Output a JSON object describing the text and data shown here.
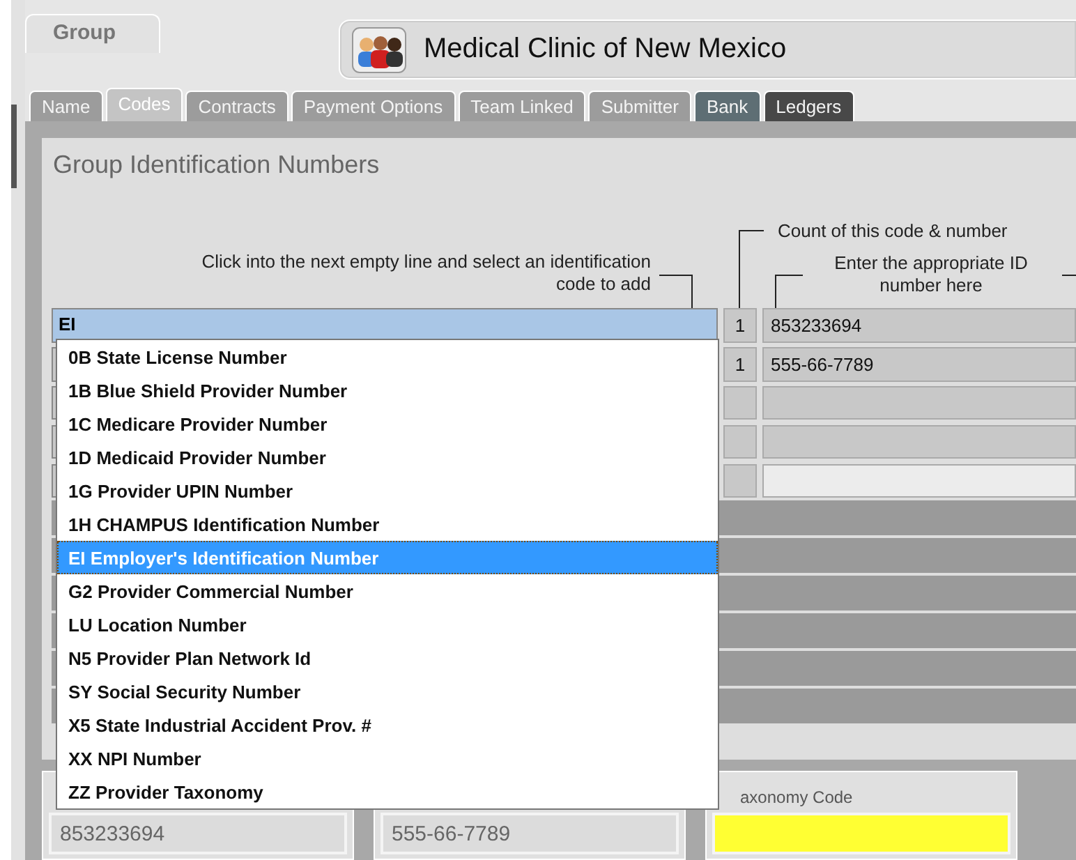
{
  "group_tab": {
    "label": "Group",
    "selected": true
  },
  "header": {
    "title": "Medical Clinic of New Mexico"
  },
  "tabs": [
    {
      "label": "Name",
      "selected": false,
      "color": "#9c9c9c"
    },
    {
      "label": "Codes",
      "selected": true,
      "color": "#c4c4c4"
    },
    {
      "label": "Contracts",
      "selected": false,
      "color": "#9c9c9c"
    },
    {
      "label": "Payment Options",
      "selected": false,
      "color": "#9c9c9c"
    },
    {
      "label": "Team Linked",
      "selected": false,
      "color": "#9c9c9c"
    },
    {
      "label": "Submitter",
      "selected": false,
      "color": "#9c9c9c"
    },
    {
      "label": "Bank",
      "selected": false,
      "color": "#5e6e74"
    },
    {
      "label": "Ledgers",
      "selected": false,
      "color": "#484848"
    }
  ],
  "section_title": "Group Identification Numbers",
  "hints": {
    "code": "Click into the next empty line and select an identification code to add",
    "count": "Count of this code & number",
    "id_number": "Enter the appropriate ID number here"
  },
  "code_field": {
    "value": "EI"
  },
  "rows": [
    {
      "count": "1",
      "id_number": "853233694"
    },
    {
      "count": "1",
      "id_number": "555-66-7789"
    },
    {},
    {},
    {
      "focused": true
    }
  ],
  "dropdown": [
    {
      "label": "0B State License Number",
      "selected": false
    },
    {
      "label": "1B Blue Shield Provider Number",
      "selected": false
    },
    {
      "label": "1C Medicare Provider Number",
      "selected": false
    },
    {
      "label": "1D Medicaid Provider Number",
      "selected": false
    },
    {
      "label": "1G Provider UPIN Number",
      "selected": false
    },
    {
      "label": "1H CHAMPUS Identification Number",
      "selected": false
    },
    {
      "label": "EI Employer's Identification Number",
      "selected": true
    },
    {
      "label": "G2 Provider Commercial Number",
      "selected": false
    },
    {
      "label": "LU Location Number",
      "selected": false
    },
    {
      "label": "N5 Provider Plan Network Id",
      "selected": false
    },
    {
      "label": "SY Social Security Number",
      "selected": false
    },
    {
      "label": "X5 State Industrial Accident Prov. #",
      "selected": false
    },
    {
      "label": "XX NPI Number",
      "selected": false
    },
    {
      "label": "ZZ Provider Taxonomy",
      "selected": false
    }
  ],
  "bottom_fields": [
    {
      "value": "853233694"
    },
    {
      "value": "555-66-7789"
    },
    {
      "label": "axonomy Code",
      "highlighted": true
    }
  ]
}
